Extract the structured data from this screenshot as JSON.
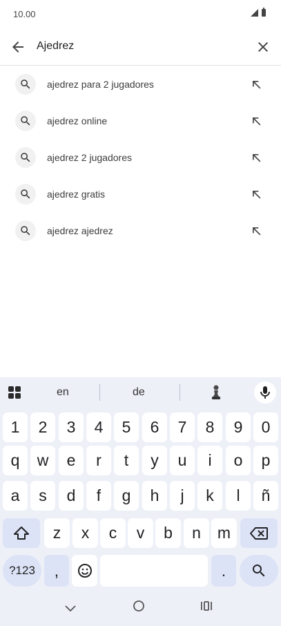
{
  "status_bar": {
    "time": "10.00"
  },
  "search": {
    "query": "Ajedrez"
  },
  "suggestions": [
    {
      "prefix": "ajedrez",
      "rest": " para 2 jugadores"
    },
    {
      "prefix": "ajedrez",
      "rest": " online"
    },
    {
      "prefix": "ajedrez",
      "rest": " 2 jugadores"
    },
    {
      "prefix": "ajedrez",
      "rest": " gratis"
    },
    {
      "prefix": "ajedrez",
      "rest": " ajedrez"
    }
  ],
  "keyboard": {
    "suggestion_words": [
      "en",
      "de"
    ],
    "row_numbers": [
      "1",
      "2",
      "3",
      "4",
      "5",
      "6",
      "7",
      "8",
      "9",
      "0"
    ],
    "row1": [
      "q",
      "w",
      "e",
      "r",
      "t",
      "y",
      "u",
      "i",
      "o",
      "p"
    ],
    "row2": [
      "a",
      "s",
      "d",
      "f",
      "g",
      "h",
      "j",
      "k",
      "l",
      "ñ"
    ],
    "row3": [
      "z",
      "x",
      "c",
      "v",
      "b",
      "n",
      "m"
    ],
    "symbols_label": "?123",
    "comma": ",",
    "period": "."
  },
  "colors": {
    "keyboard_bg": "#eef0f8",
    "special_key": "#dde3f6",
    "key": "#ffffff"
  }
}
